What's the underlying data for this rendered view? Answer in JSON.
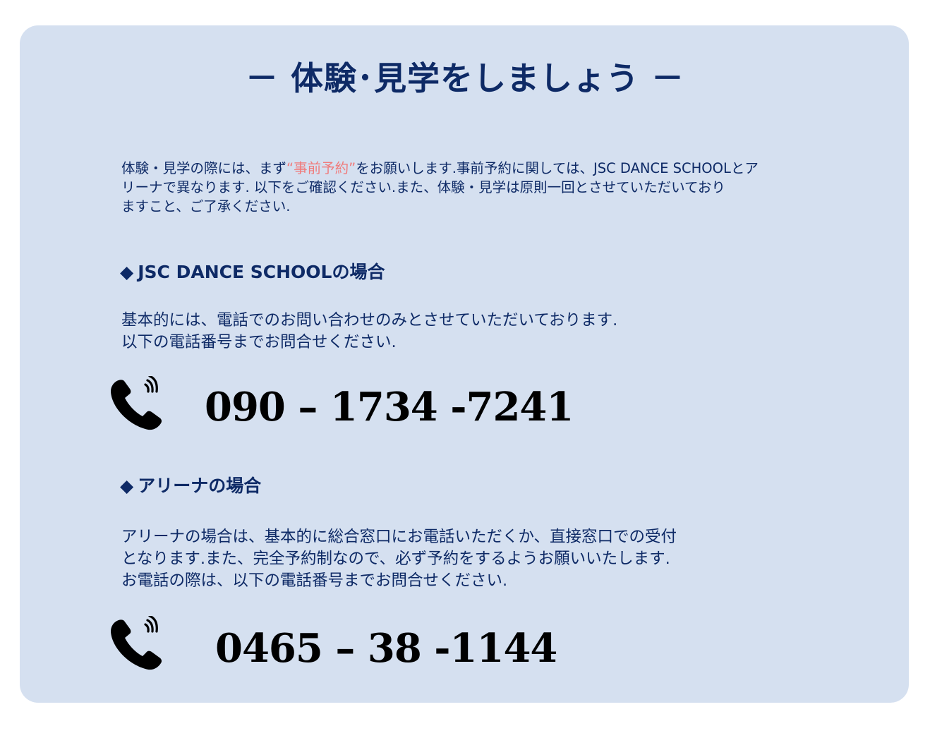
{
  "title": "－ 体験･見学をしましょう －",
  "intro": {
    "before": "体験・見学の際には、まず",
    "highlight": "“事前予約”",
    "line1_after": "をお願いします.事前予約に関しては、JSC DANCE SCHOOLとア",
    "line2": "リーナで異なります. 以下をご確認ください.また、体験・見学は原則一回とさせていただいており",
    "line3": "ますこと、ご了承ください.",
    "accent_color": "#f07b7b"
  },
  "school": {
    "diamond": "◆",
    "heading": "JSC DANCE SCHOOLの場合",
    "lines": [
      "基本的には、電話でのお問い合わせのみとさせていただいております.",
      "以下の電話番号までお問合せください."
    ],
    "phone_icon": "phone-icon",
    "phone": "090 – 1734 -7241"
  },
  "arena": {
    "diamond": "◆",
    "heading": "アリーナの場合",
    "lines": [
      "アリーナの場合は、基本的に総合窓口にお電話いただくか、直接窓口での受付",
      "となります.また、完全予約制なので、必ず予約をするようお願いいたします.",
      "お電話の際は、以下の電話番号までお問合せください."
    ],
    "phone_icon": "phone-icon",
    "phone": "0465 – 38 -1144"
  },
  "colors": {
    "panel_background": "#d5e0f0",
    "text_navy": "#0e2a66"
  }
}
